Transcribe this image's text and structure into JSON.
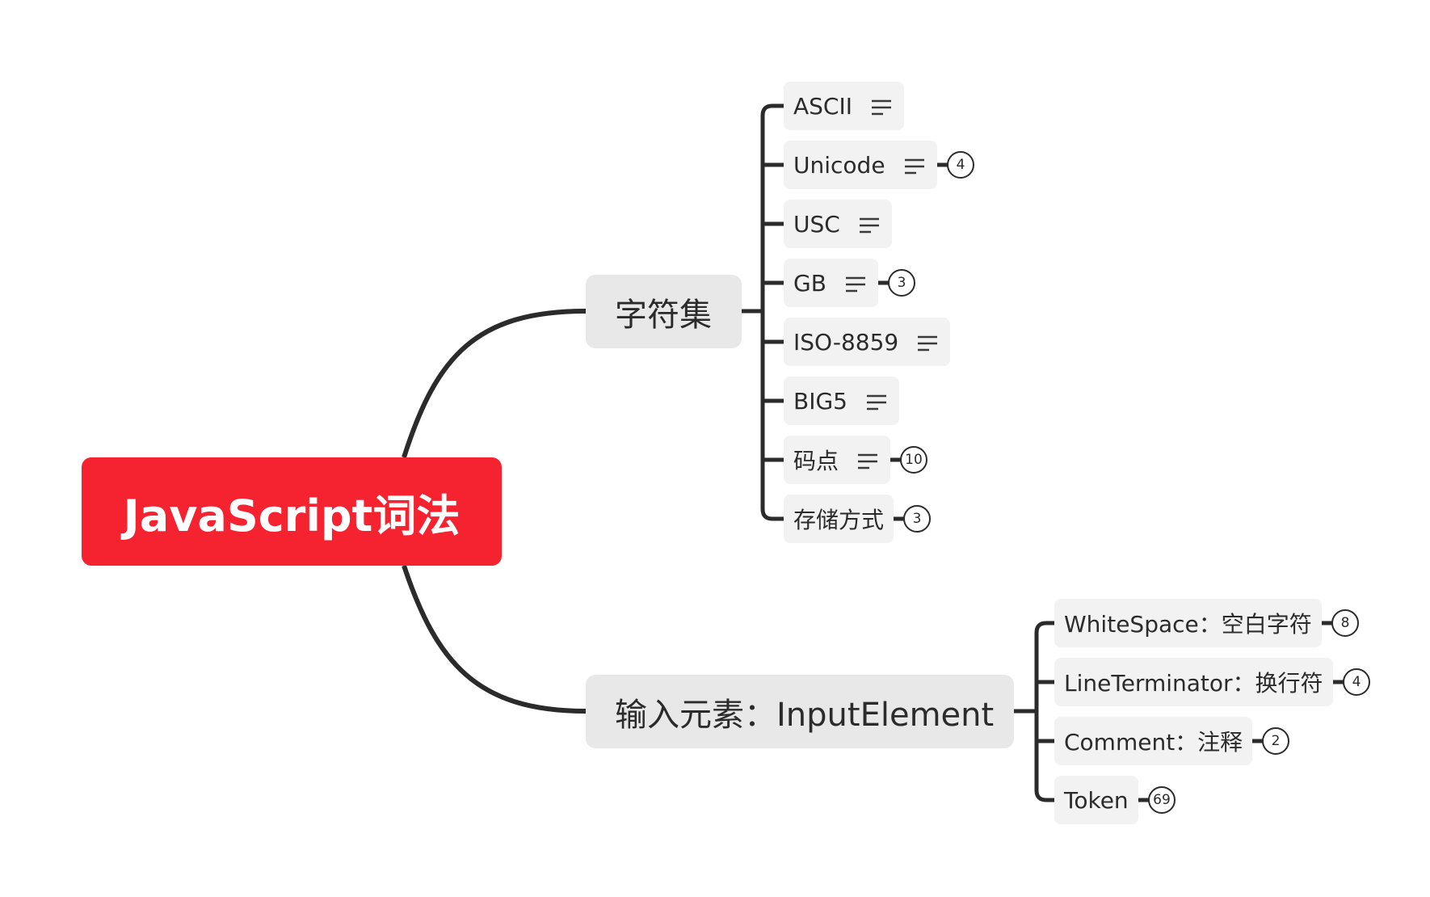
{
  "root": {
    "label": "JavaScript词法"
  },
  "branches": [
    {
      "label": "字符集",
      "children": [
        {
          "label": "ASCII",
          "note": true,
          "count": null
        },
        {
          "label": "Unicode",
          "note": true,
          "count": "4"
        },
        {
          "label": "USC",
          "note": true,
          "count": null
        },
        {
          "label": "GB",
          "note": true,
          "count": "3"
        },
        {
          "label": "ISO-8859",
          "note": true,
          "count": null
        },
        {
          "label": "BIG5",
          "note": true,
          "count": null
        },
        {
          "label": "码点",
          "note": true,
          "count": "10"
        },
        {
          "label": "存储方式",
          "note": false,
          "count": "3"
        }
      ]
    },
    {
      "label": "输入元素：InputElement",
      "children": [
        {
          "label": "WhiteSpace：空白字符",
          "note": false,
          "count": "8"
        },
        {
          "label": "LineTerminator：换行符",
          "note": false,
          "count": "4"
        },
        {
          "label": "Comment：注释",
          "note": false,
          "count": "2"
        },
        {
          "label": "Token",
          "note": false,
          "count": "69"
        }
      ]
    }
  ],
  "colors": {
    "root": "#f52230",
    "branch_bg": "#e8e8e8",
    "leaf_bg": "#f2f2f2",
    "line": "#2b2b2b"
  },
  "icons": {
    "note": "note-lines-icon",
    "count": "collapsed-count-badge"
  }
}
